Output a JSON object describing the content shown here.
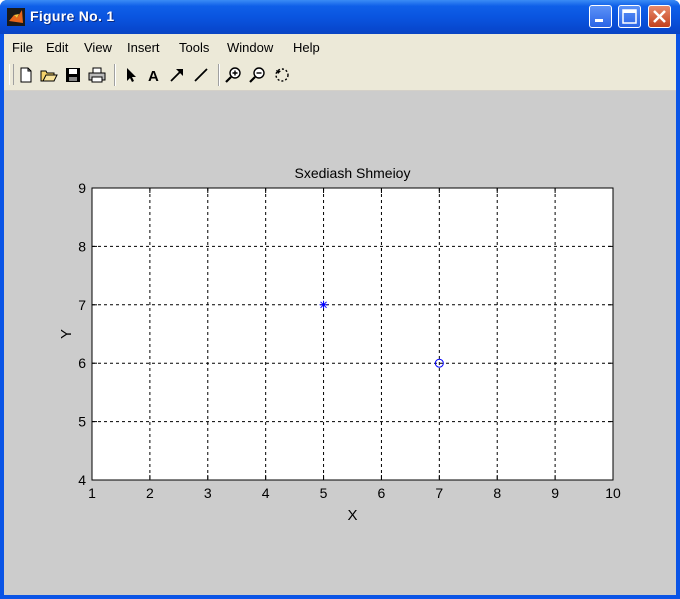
{
  "window": {
    "title": "Figure No. 1"
  },
  "menu": {
    "items": [
      {
        "label": "File"
      },
      {
        "label": "Edit"
      },
      {
        "label": "View"
      },
      {
        "label": "Insert"
      },
      {
        "label": "Tools"
      },
      {
        "label": "Window"
      },
      {
        "label": "Help"
      }
    ]
  },
  "toolbar": {
    "tools": [
      "new-file-icon",
      "open-folder-icon",
      "save-icon",
      "print-icon",
      "arrow-select-icon",
      "text-insert-icon",
      "arrow-insert-icon",
      "line-insert-icon",
      "zoom-in-icon",
      "zoom-out-icon",
      "rotate-icon"
    ]
  },
  "chart_data": {
    "type": "scatter",
    "title": "Sxediash Shmeioy",
    "xlabel": "X",
    "ylabel": "Y",
    "xlim": [
      1,
      10
    ],
    "ylim": [
      4,
      9
    ],
    "xticks": [
      "1",
      "2",
      "3",
      "4",
      "5",
      "6",
      "7",
      "8",
      "9",
      "10"
    ],
    "yticks": [
      "4",
      "5",
      "6",
      "7",
      "8",
      "9"
    ],
    "grid": true,
    "series": [
      {
        "marker": "asterisk",
        "color": "#0000ff",
        "points": [
          {
            "x": 5,
            "y": 7
          }
        ]
      },
      {
        "marker": "circle",
        "color": "#0000ff",
        "points": [
          {
            "x": 7,
            "y": 6
          }
        ]
      }
    ]
  }
}
